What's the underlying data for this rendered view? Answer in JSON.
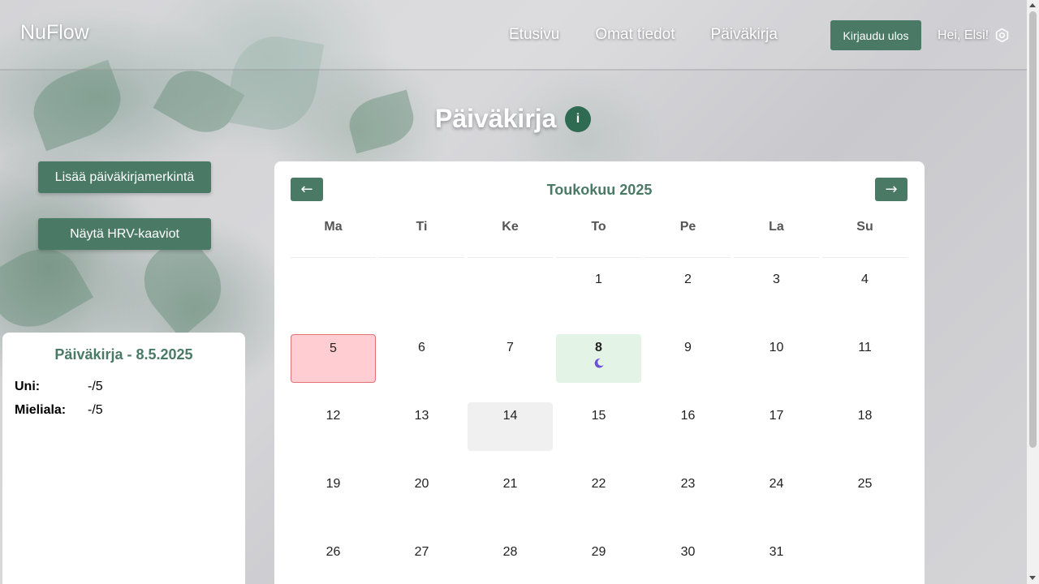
{
  "header": {
    "brand": "NuFlow",
    "nav": [
      "Etusivu",
      "Omat tiedot",
      "Päiväkirja"
    ],
    "logout_label": "Kirjaudu ulos",
    "greeting": "Hei, Elsi!"
  },
  "page": {
    "title": "Päiväkirja",
    "info_label": "i"
  },
  "sidebar": {
    "add_entry_label": "Lisää päiväkirjamerkintä",
    "hrv_label": "Näytä HRV-kaaviot"
  },
  "summary": {
    "title": "Päiväkirja - 8.5.2025",
    "rows": [
      {
        "label": "Uni:",
        "value": "-/5"
      },
      {
        "label": "Mieliala:",
        "value": "-/5"
      }
    ]
  },
  "calendar": {
    "month": "Toukokuu 2025",
    "prev_label": "←",
    "next_label": "→",
    "weekdays": [
      "Ma",
      "Ti",
      "Ke",
      "To",
      "Pe",
      "La",
      "Su"
    ],
    "days": [
      "1",
      "2",
      "3",
      "4",
      "5",
      "6",
      "7",
      "8",
      "9",
      "10",
      "11",
      "12",
      "13",
      "14",
      "15",
      "16",
      "17",
      "18",
      "19",
      "20",
      "21",
      "22",
      "23",
      "24",
      "25",
      "26",
      "27",
      "28",
      "29",
      "30",
      "31"
    ],
    "first_weekday_index": 3,
    "highlighted": {
      "red": "5",
      "green": "8",
      "grey": "14"
    },
    "moon_day": "8",
    "colors": {
      "accent": "#4a7a66",
      "red_bg": "#ffcdd2",
      "green_bg": "#e3f4e6",
      "moon": "#6b4fd8"
    }
  },
  "icons": {
    "settings": "gear-icon",
    "moon": "moon-icon"
  }
}
